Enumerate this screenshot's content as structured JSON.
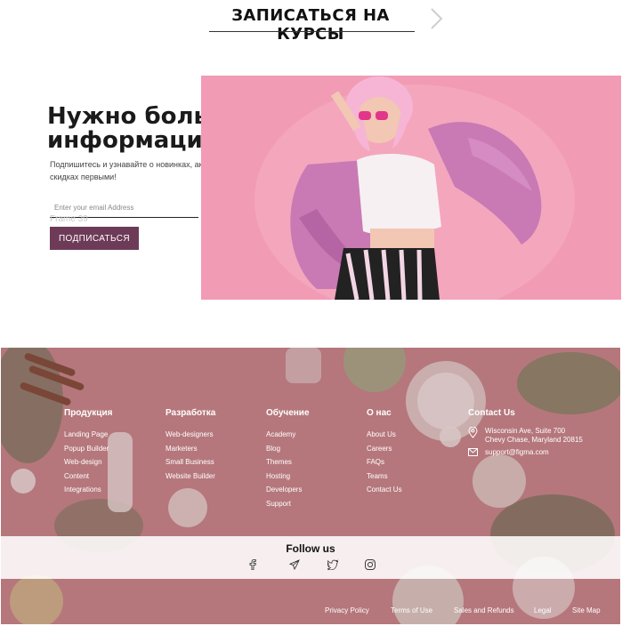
{
  "cta": {
    "label": "ЗАПИСАТЬСЯ НА КУРСЫ"
  },
  "newsletter": {
    "title": "Нужно больше информации?",
    "subtitle": "Подпишитесь и узнавайте о новинках, акциях и скидках первыми!",
    "email_placeholder": "Enter your email Address",
    "frame_label": "Frame 39",
    "button_label": "ПОДПИСАТЬСЯ"
  },
  "footer": {
    "columns": [
      {
        "title": "Продукция",
        "links": [
          "Landing Page",
          "Popup Builder",
          "Web-design",
          "Content",
          "Integrations"
        ]
      },
      {
        "title": "Разработка",
        "links": [
          "Web-designers",
          "Marketers",
          "Small Business",
          "Website Builder"
        ]
      },
      {
        "title": "Обучение",
        "links": [
          "Academy",
          "Blog",
          "Themes",
          "Hosting",
          "Developers",
          "Support"
        ]
      },
      {
        "title": "О нас",
        "links": [
          "About Us",
          "Careers",
          "FAQs",
          "Teams",
          "Contact Us"
        ]
      }
    ],
    "contact": {
      "title": "Contact Us",
      "address_line1": "Wisconsin Ave, Suite 700",
      "address_line2": "Chevy Chase, Maryland 20815",
      "email": "support@figma.com"
    },
    "follow": {
      "title": "Follow us",
      "icons": [
        "facebook-icon",
        "telegram-icon",
        "twitter-icon",
        "instagram-icon"
      ]
    },
    "legal": [
      "Privacy Policy",
      "Terms of Use",
      "Sales and Refunds",
      "Legal",
      "Site Map"
    ]
  },
  "colors": {
    "accent": "#6d3b58",
    "hero_bg": "#f29bb4",
    "footer_bg": "#c98b8f"
  }
}
